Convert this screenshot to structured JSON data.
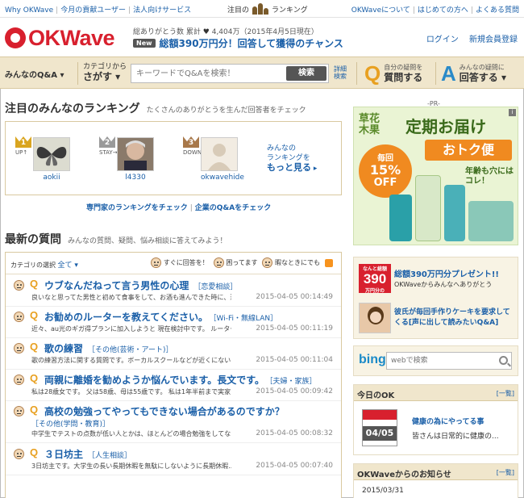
{
  "topbar": {
    "left_links": [
      "Why OKWave",
      "今月の貢献ユーザー",
      "法人向けサービス"
    ],
    "ranking_prefix": "注目の",
    "ranking_suffix": "ランキング",
    "right_links": [
      "OKWaveについて",
      "はじめての方へ",
      "よくある質問"
    ]
  },
  "header": {
    "logo_text": "OKWave",
    "stats_label": "総ありがとう数 累計",
    "stats_heart": "♥",
    "stats_count": "4,404万",
    "stats_date": "（2015年4月5日現在）",
    "new_badge": "New",
    "news_text": "総額390万円分！回答して獲得のチャンス",
    "login": "ログイン",
    "register": "新規会員登録"
  },
  "nav": {
    "mine": "みんなのQ&A ▾",
    "cat_small": "カテゴリから",
    "cat_big": "さがす ▾",
    "search_placeholder": "キーワードでQ&Aを検索！",
    "search_button": "検索",
    "detail_1": "詳細",
    "detail_2": "検索",
    "ask_letter": "Q",
    "ask_small": "自分の疑問を",
    "ask_big": "質問する",
    "answer_letter": "A",
    "answer_small": "みんなの疑問に",
    "answer_big": "回答する ▾"
  },
  "ranking": {
    "title": "注目のみんなのランキング",
    "subtitle": "たくさんのありがとうを生んだ回答者をチェック",
    "users": [
      {
        "rank": "1",
        "trend": "UP↑",
        "name": "aokii",
        "color": "#d9a520"
      },
      {
        "rank": "2",
        "trend": "STAY→",
        "name": "l4330",
        "color": "#9a9a9a"
      },
      {
        "rank": "3",
        "trend": "DOWN↓",
        "name": "okwavehide",
        "color": "#a8784a"
      }
    ],
    "more_1": "みんなの",
    "more_2": "ランキングを",
    "more_3": "もっと見る",
    "more_arrow": "▸",
    "check_expert": "専門家のランキングをチェック",
    "check_sep": "|",
    "check_company": "企業のQ&Aをチェック"
  },
  "questions": {
    "title": "最新の質問",
    "subtitle": "みんなの質問、疑問、悩み相談に答えてみよう！",
    "category_label": "カテゴリの選択",
    "category_value": "全て ▾",
    "legend_urgent": "すぐに回答を！",
    "legend_trouble": "困ってます",
    "legend_free": "暇なときにでも",
    "q_letter": "Q",
    "items": [
      {
        "title": "ウブなんだねって言う男性の心理",
        "tag": "［恋愛相談］",
        "snippet": "良いなと思ってた男性と初めて食事をして、お酒も進んできた時に、違う...",
        "date": "2015-04-05 00:14:49"
      },
      {
        "title": "お勧めのルーターを教えてください。",
        "tag": "［Wi-Fi・無線LAN］",
        "snippet": "近々、au光のギガ得プランに加入しようと 現在検討中です。 ルーター...",
        "date": "2015-04-05 00:11:19"
      },
      {
        "title": "歌の練習",
        "tag": "［その他(芸術・アート)］",
        "snippet": "歌の練習方法に関する質問です。ボーカルスクールなどが近くにないた...",
        "date": "2015-04-05 00:11:04"
      },
      {
        "title": "両親に離婚を勧めようか悩んでいます。長文です。",
        "tag": "［夫婦・家族］",
        "snippet": "私は28歳女です。 父は58歳、母は55歳です。 私は1年半前まで実家を...",
        "date": "2015-04-05 00:09:42"
      },
      {
        "title": "高校の勉強ってやってもできない場合があるのですか？",
        "tag": "",
        "tag_line": "［その他(学問・教育)］",
        "snippet": "中学生でテストの点数が低い人とかは、ほとんどの場合勉強をしてない...",
        "date": "2015-04-05 00:08:32"
      },
      {
        "title": "３日坊主",
        "tag": "［人生相談］",
        "snippet": "3日坊主です。大学生の長い長期休暇を無駄にしないように長期休暇...",
        "date": "2015-04-05 00:07:40"
      }
    ]
  },
  "sidebar": {
    "pr_label": "-PR-",
    "ad_info": "i",
    "ad_brand_1": "草花",
    "ad_brand_2": "木果",
    "ad_headline": "定期お届け",
    "ad_sub": "おトク便",
    "ad_off_1": "毎回",
    "ad_off_2": "15%",
    "ad_off_3": "OFF",
    "ad_note_1": "年齢も穴には",
    "ad_note_2": "コレ！",
    "promo_badge_top": "なんと総額",
    "promo_badge_num": "390",
    "promo_badge_unit": "万円分の",
    "promo_title": "総額390万円分プレゼント!!",
    "promo_sub": "OKWaveからみんなへありがとう",
    "promo_story_1": "彼氏が毎回手作りケーキを要求して",
    "promo_story_2": "くる[声に出して読みたいQ&A]",
    "bing_logo": "bing",
    "bing_placeholder": "webで検索",
    "today_title": "今日のOK",
    "today_link": "[一覧]",
    "today_date": "04/05",
    "today_item": "健康の為にやってる事",
    "today_snip": "皆さんは日常的に健康の...",
    "notice_title": "OKWaveからのお知らせ",
    "notice_link": "[一覧]",
    "notice_date": "2015/03/31"
  }
}
